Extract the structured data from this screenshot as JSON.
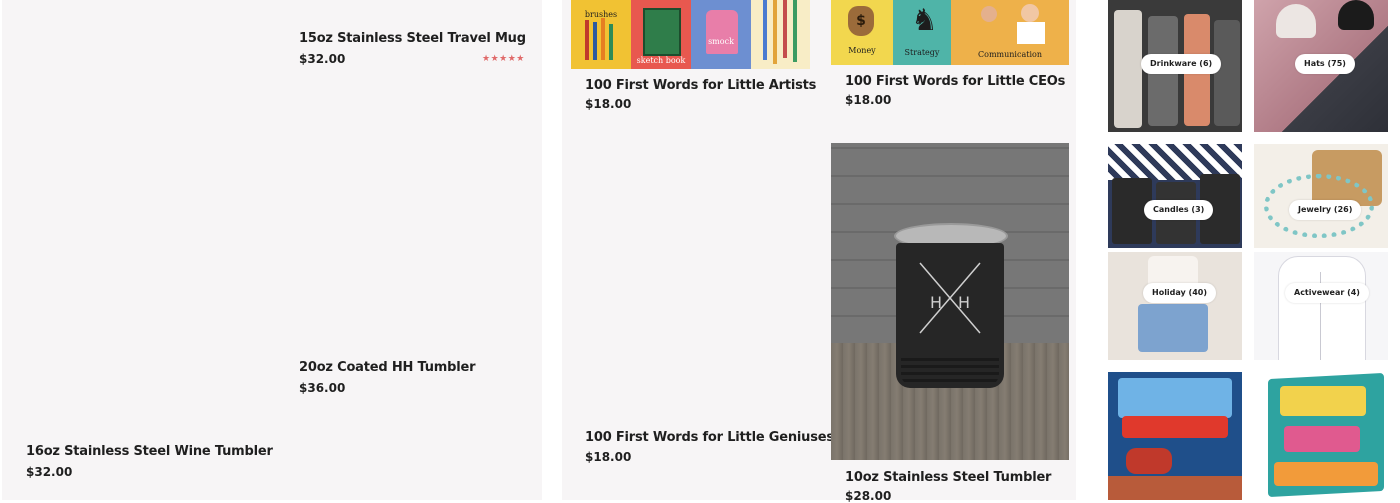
{
  "products": {
    "travel_mug": {
      "title": "15oz Stainless Steel Travel Mug",
      "price": "$32.00",
      "rating": "★★★★★"
    },
    "coated_tumbler": {
      "title": "20oz Coated HH Tumbler",
      "price": "$36.00"
    },
    "wine_tumbler": {
      "title": "16oz Stainless Steel Wine Tumbler",
      "price": "$32.00"
    },
    "artists_book": {
      "title": "100 First Words for Little Artists",
      "price": "$18.00",
      "art_labels": [
        "brushes",
        "sketch book",
        "smock"
      ]
    },
    "ceos_book": {
      "title": "100 First Words for Little CEOs",
      "price": "$18.00",
      "art_labels": [
        "Money",
        "Strategy",
        "Communication"
      ]
    },
    "geniuses_book": {
      "title": "100 First Words for Little Geniuses",
      "price": "$18.00"
    },
    "steel_tumbler": {
      "title": "10oz Stainless Steel Tumbler",
      "price": "$28.00"
    }
  },
  "categories": [
    {
      "label": "Drinkware (6)"
    },
    {
      "label": "Hats (75)"
    },
    {
      "label": "Candles (3)"
    },
    {
      "label": "Jewelry (26)"
    },
    {
      "label": "Holiday (40)"
    },
    {
      "label": "Activewear (4)"
    }
  ],
  "colors": {
    "panel": "#f7f5f6",
    "rating": "#e06a6a"
  }
}
